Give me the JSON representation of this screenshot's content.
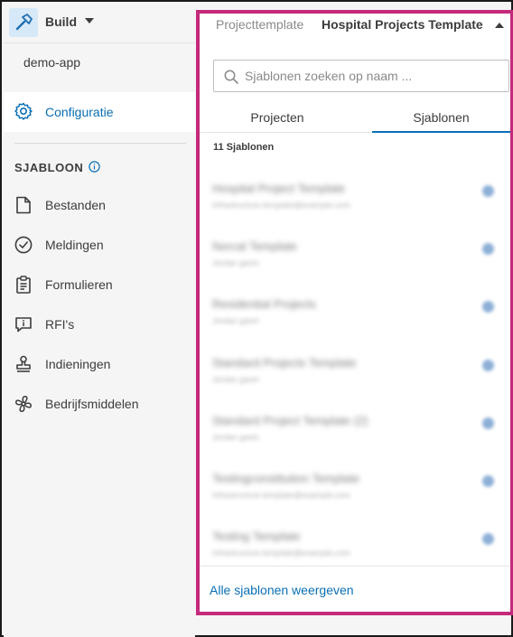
{
  "app": {
    "name": "Build",
    "project": "demo-app"
  },
  "sidebar": {
    "config_label": "Configuratie",
    "section_title": "SJABLOON",
    "items": [
      {
        "label": "Bestanden",
        "icon": "file-icon"
      },
      {
        "label": "Meldingen",
        "icon": "check-circle-icon"
      },
      {
        "label": "Formulieren",
        "icon": "clipboard-icon"
      },
      {
        "label": "RFI's",
        "icon": "speech-bubble-info-icon"
      },
      {
        "label": "Indieningen",
        "icon": "stamp-icon"
      },
      {
        "label": "Bedrijfsmiddelen",
        "icon": "fan-icon"
      }
    ]
  },
  "panel": {
    "crumb": "Projecttemplate",
    "crumb_active": "Hospital Projects Template",
    "search_placeholder": "Sjablonen zoeken op naam ...",
    "tabs": [
      "Projecten",
      "Sjablonen"
    ],
    "active_tab": "Sjablonen",
    "count": "11 Sjablonen",
    "templates": [
      {
        "name": "Hospital Project Template",
        "sub": "Infrastructure.template@example.com"
      },
      {
        "name": "Norcal Template",
        "sub": "Jordan gaoin"
      },
      {
        "name": "Residential Projects",
        "sub": "Jordan gaoin"
      },
      {
        "name": "Standard Projects Template",
        "sub": "Jordan gaoin"
      },
      {
        "name": "Standard Project Template (2)",
        "sub": "Jordan gaoin"
      },
      {
        "name": "Testingconstitution Template",
        "sub": "Infrastructure.template@example.com"
      },
      {
        "name": "Testing Template",
        "sub": "Infrastructure.template@example.com"
      }
    ],
    "footer_link": "Alle sjablonen weergeven"
  },
  "colors": {
    "accent": "#0a6fb5",
    "highlight_border": "#c42a7c",
    "sidebar_bg": "#f5f5f5"
  }
}
